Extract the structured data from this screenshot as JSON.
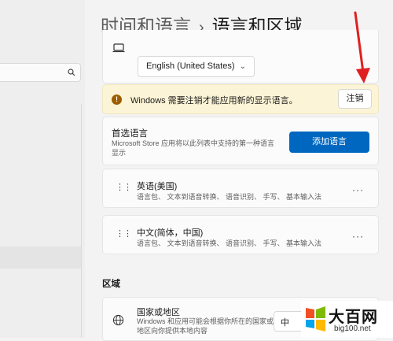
{
  "header": {
    "parent": "时间和语言",
    "separator": "›",
    "title": "语言和区域"
  },
  "display_language": {
    "selected": "English (United States)"
  },
  "warning": {
    "text": "Windows 需要注销才能应用新的显示语言。",
    "signout_label": "注销"
  },
  "preferred": {
    "title": "首选语言",
    "description": "Microsoft Store 应用将以此列表中支持的第一种语言显示",
    "add_label": "添加语言"
  },
  "languages": [
    {
      "name": "英语(美国)",
      "features": "语言包、 文本到语音转换、 语音识别、 手写、 基本输入法"
    },
    {
      "name": "中文(简体，中国)",
      "features": "语言包、 文本到语音转换、 语音识别、 手写、 基本输入法"
    }
  ],
  "more_glyph": "···",
  "region": {
    "heading": "区域",
    "country_title": "国家或地区",
    "country_desc": "Windows 和应用可能会根据你所在的国家或地区向你提供本地内容",
    "country_value": "中"
  },
  "watermark": {
    "title": "大百网",
    "url": "big100.net"
  },
  "colors": {
    "accent": "#0067c0",
    "warning_bg": "#fcf4d6",
    "annotation_arrow": "#e02020"
  }
}
